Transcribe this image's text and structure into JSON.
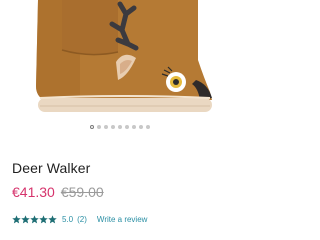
{
  "product": {
    "name": "Deer Walker",
    "price_sale": "€41.30",
    "price_original": "€59.00",
    "rating_value": "5.0",
    "rating_count": "(2)",
    "rating_stars": 5,
    "write_review_label": "Write a review",
    "image_alt_icon": "deer-boot-image"
  },
  "carousel": {
    "total": 9,
    "active_index": 0
  },
  "colors": {
    "sale": "#d6336c",
    "strike": "#9a9a9a",
    "link": "#2a8fa4",
    "star": "#1e6e74"
  }
}
